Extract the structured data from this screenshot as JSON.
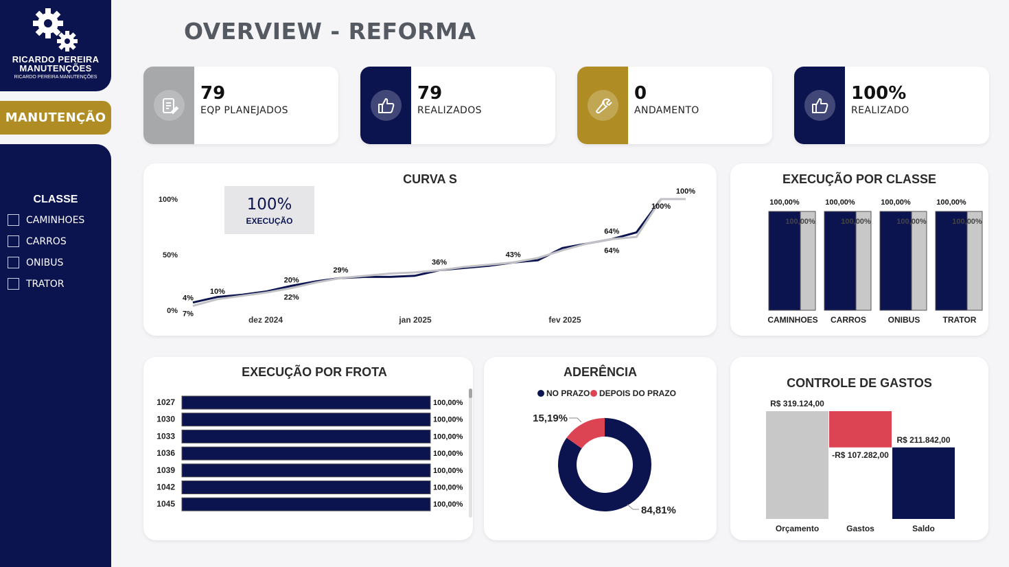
{
  "brand": {
    "line1": "RICARDO PEREIRA",
    "line2": "MANUTENÇÕES",
    "line3": "RICARDO PEREIRA MANUTENÇÕES"
  },
  "nav": {
    "active": "MANUTENÇÃO"
  },
  "filter": {
    "title": "CLASSE",
    "items": [
      "CAMINHOES",
      "CARROS",
      "ONIBUS",
      "TRATOR"
    ]
  },
  "page": {
    "title": "OVERVIEW - REFORMA"
  },
  "kpis": [
    {
      "value": "79",
      "label": "EQP PLANEJADOS",
      "color": "#a7a8aa",
      "icon": "document-edit-icon"
    },
    {
      "value": "79",
      "label": "REALIZADOS",
      "color": "#0c1450",
      "icon": "thumbs-up-icon"
    },
    {
      "value": "0",
      "label": "ANDAMENTO",
      "color": "#b08d24",
      "icon": "wrench-icon"
    },
    {
      "value": "100%",
      "label": "REALIZADO",
      "color": "#0c1450",
      "icon": "thumbs-up-icon"
    }
  ],
  "colors": {
    "navy": "#0c1450",
    "gray": "#c8c8c8",
    "gold": "#b08d24",
    "red": "#dc4453"
  },
  "chart_data": [
    {
      "type": "line",
      "title": "CURVA S",
      "y_ticks": [
        "100%",
        "50%",
        "0%"
      ],
      "ylim": [
        0,
        100
      ],
      "x_ticks": [
        "dez 2024",
        "jan 2025",
        "fev 2025"
      ],
      "kpi_box": {
        "value": "100%",
        "label": "EXECUÇÃO"
      },
      "series": [
        {
          "values": [
            7,
            12,
            14,
            17,
            22,
            26,
            29,
            30,
            30,
            31,
            36,
            38,
            40,
            43,
            45,
            56,
            60,
            64,
            70,
            100,
            100
          ]
        },
        {
          "values": [
            4,
            10,
            13,
            16,
            20,
            25,
            29,
            31,
            33,
            34,
            36,
            39,
            41,
            43,
            47,
            54,
            60,
            64,
            66,
            100,
            100
          ]
        }
      ],
      "labels_top": [
        {
          "i": 0,
          "t": "4%"
        },
        {
          "i": 1,
          "t": "10%"
        },
        {
          "i": 4,
          "t": "20%"
        },
        {
          "i": 6,
          "t": "29%"
        },
        {
          "i": 10,
          "t": "36%"
        },
        {
          "i": 13,
          "t": "43%"
        },
        {
          "i": 17,
          "t": "64%"
        },
        {
          "i": 20,
          "t": "100%"
        }
      ],
      "labels_bottom": [
        {
          "i": 0,
          "t": "7%"
        },
        {
          "i": 4,
          "t": "22%"
        },
        {
          "i": 17,
          "t": "64%"
        },
        {
          "i": 19,
          "t": "100%"
        }
      ]
    },
    {
      "type": "bar",
      "title": "EXECUÇÃO POR CLASSE",
      "categories": [
        "CAMINHOES",
        "CARROS",
        "ONIBUS",
        "TRATOR"
      ],
      "series": [
        {
          "values": [
            100,
            100,
            100,
            100
          ],
          "labels": [
            "100,00%",
            "100,00%",
            "100,00%",
            "100,00%"
          ]
        },
        {
          "values": [
            100,
            100,
            100,
            100
          ],
          "labels": [
            "100,00%",
            "100,00%",
            "100,00%",
            "100,00%"
          ]
        }
      ]
    },
    {
      "type": "bar",
      "orientation": "horizontal",
      "title": "EXECUÇÃO POR FROTA",
      "categories": [
        "1027",
        "1030",
        "1033",
        "1036",
        "1039",
        "1042",
        "1045"
      ],
      "values": [
        100,
        100,
        100,
        100,
        100,
        100,
        100
      ],
      "labels": [
        "100,00%",
        "100,00%",
        "100,00%",
        "100,00%",
        "100,00%",
        "100,00%",
        "100,00%"
      ]
    },
    {
      "type": "pie",
      "title": "ADERÊNCIA",
      "legend": [
        "NO PRAZO",
        "DEPOIS DO PRAZO"
      ],
      "values": [
        84.81,
        15.19
      ],
      "labels": [
        "84,81%",
        "15,19%"
      ]
    },
    {
      "type": "bar",
      "subtype": "waterfall",
      "title": "CONTROLE DE GASTOS",
      "categories": [
        "Orçamento",
        "Gastos",
        "Saldo"
      ],
      "values": [
        319124,
        -107282,
        211842
      ],
      "labels": [
        "R$ 319.124,00",
        "-R$ 107.282,00",
        "R$ 211.842,00"
      ]
    }
  ]
}
